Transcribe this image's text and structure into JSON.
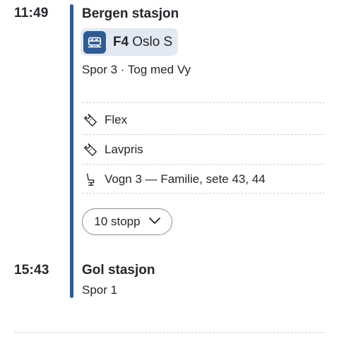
{
  "departure": {
    "time": "11:49",
    "station": "Bergen stasjon",
    "platform_info": "Spor 3 · Tog med Vy"
  },
  "line": {
    "icon": "train-icon",
    "code": "F4",
    "destination": "Oslo S",
    "color": "#2f5b94"
  },
  "tickets": [
    {
      "icon": "ticket-icon",
      "label": "Flex"
    },
    {
      "icon": "ticket-icon",
      "label": "Lavpris"
    },
    {
      "icon": "seat-icon",
      "label": "Vogn 3 — Familie, sete 43, 44"
    }
  ],
  "stops_button": {
    "label": "10 stopp",
    "icon": "chevron-down-icon"
  },
  "arrival": {
    "time": "15:43",
    "station": "Gol stasjon",
    "platform_info": "Spor 1"
  }
}
